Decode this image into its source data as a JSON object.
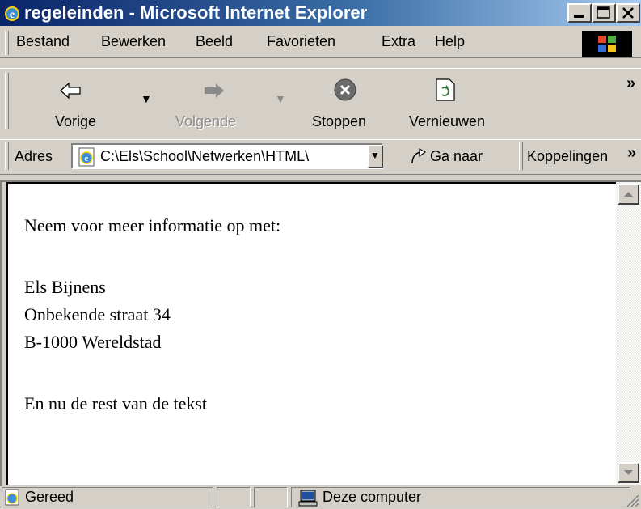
{
  "window": {
    "title": "regeleinden - Microsoft Internet Explorer",
    "controls": [
      "minimize",
      "maximize",
      "close"
    ]
  },
  "menu": {
    "items": [
      "Bestand",
      "Bewerken",
      "Beeld",
      "Favorieten",
      "Extra",
      "Help"
    ]
  },
  "toolbar": {
    "back_label": "Vorige",
    "forward_label": "Volgende",
    "stop_label": "Stoppen",
    "refresh_label": "Vernieuwen",
    "overflow": "»"
  },
  "address": {
    "label": "Adres",
    "value": "C:\\Els\\School\\Netwerken\\HTML\\",
    "go_label": "Ga naar",
    "links_label": "Koppelingen",
    "links_overflow": "»"
  },
  "page": {
    "line1": "Neem voor meer informatie op met:",
    "line2": "Els Bijnens",
    "line3": "Onbekende straat 34",
    "line4": "B-1000 Wereldstad",
    "line5": "En nu de rest van de tekst"
  },
  "status": {
    "text": "Gereed",
    "zone": "Deze computer"
  },
  "icons": {
    "title": "ie-logo-icon",
    "back": "back-arrow-icon",
    "forward": "forward-arrow-icon",
    "stop": "stop-icon",
    "refresh": "refresh-icon",
    "address": "ie-page-icon",
    "go": "go-arrow-icon",
    "zone": "computer-icon",
    "windows": "windows-logo-icon"
  }
}
